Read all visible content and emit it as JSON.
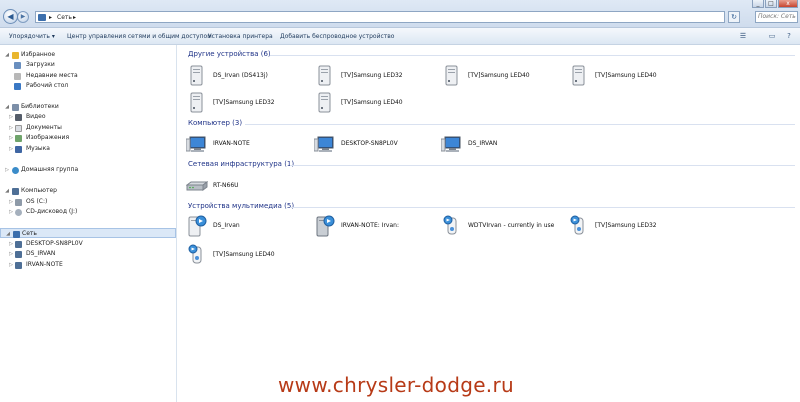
{
  "window": {
    "controls": [
      "_",
      "□",
      "x"
    ]
  },
  "address": {
    "crumbs": [
      "▸",
      "Сеть",
      "▸"
    ],
    "search_placeholder": "Поиск: Сеть"
  },
  "toolbar": {
    "organize": "Упорядочить ▾",
    "network_center": "Центр управления сетями и общим доступом",
    "printer": "Установка принтера",
    "wireless": "Добавить беспроводное устройство"
  },
  "sidebar": {
    "favorites": "Избранное",
    "downloads": "Загрузки",
    "recent": "Недавние места",
    "desktop": "Рабочий стол",
    "libraries": "Библиотеки",
    "video": "Видео",
    "documents": "Документы",
    "images": "Изображения",
    "music": "Музыка",
    "homegroup": "Домашняя группа",
    "computer": "Компьютер",
    "drive_c": "OS (C:)",
    "drive_d": "CD-дисковод (J:)",
    "network": "Сеть",
    "net1": "DESKTOP-SN8PL0V",
    "net2": "DS_IRVAN",
    "net3": "IRVAN-NOTE"
  },
  "groups": {
    "other": {
      "title": "Другие устройства (6)",
      "items": [
        "DS_Irvan (DS413j)",
        "[TV]Samsung LED32",
        "[TV]Samsung LED40",
        "[TV]Samsung LED40",
        "[TV]Samsung LED32",
        "[TV]Samsung LED40"
      ]
    },
    "computer": {
      "title": "Компьютер (3)",
      "items": [
        "IRVAN-NOTE",
        "DESKTOP-SN8PL0V",
        "DS_IRVAN"
      ]
    },
    "infra": {
      "title": "Сетевая инфраструктура (1)",
      "items": [
        "RT-N66U"
      ]
    },
    "media": {
      "title": "Устройства мультимедиа (5)",
      "items": [
        "DS_Irvan",
        "IRVAN-NOTE: Irvan:",
        "WDTVIrvan - currently in use",
        "[TV]Samsung LED32",
        "[TV]Samsung LED40"
      ]
    }
  },
  "watermark": "www.chrysler-dodge.ru"
}
